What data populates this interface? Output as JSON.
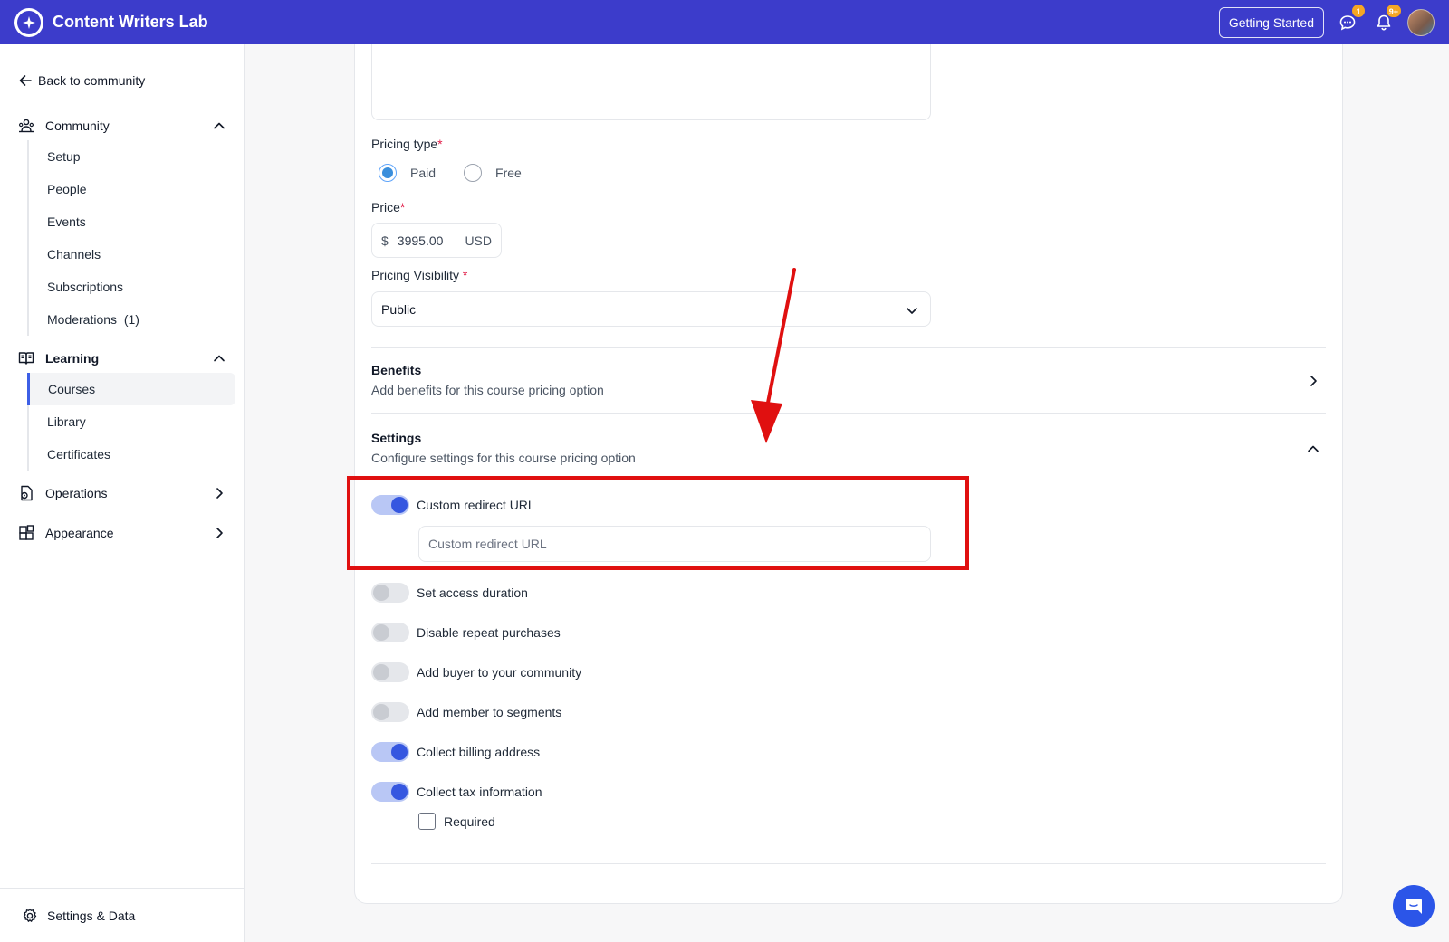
{
  "header": {
    "app_title": "Content Writers Lab",
    "getting_started": "Getting Started",
    "messages_badge": "1",
    "notifications_badge": "9+"
  },
  "sidebar": {
    "back_label": "Back to community",
    "community": {
      "label": "Community",
      "items": [
        "Setup",
        "People",
        "Events",
        "Channels",
        "Subscriptions",
        "Moderations  (1)"
      ]
    },
    "learning": {
      "label": "Learning",
      "items": [
        "Courses",
        "Library",
        "Certificates"
      ],
      "active": "Courses"
    },
    "operations_label": "Operations",
    "appearance_label": "Appearance",
    "footer_label": "Settings & Data"
  },
  "form": {
    "pricing_type_label": "Pricing type",
    "required_mark": "*",
    "pricing_options": [
      {
        "label": "Paid",
        "selected": true
      },
      {
        "label": "Free",
        "selected": false
      }
    ],
    "price_label": "Price",
    "currency_symbol": "$",
    "price_value": "3995.00",
    "currency_code": "USD",
    "visibility_label": "Pricing Visibility",
    "visibility_value": "Public",
    "benefits": {
      "title": "Benefits",
      "description": "Add benefits for this course pricing option"
    },
    "settings": {
      "title": "Settings",
      "description": "Configure settings for this course pricing option"
    },
    "toggles": [
      {
        "label": "Custom redirect URL",
        "on": true
      },
      {
        "label": "Set access duration",
        "on": false
      },
      {
        "label": "Disable repeat purchases",
        "on": false
      },
      {
        "label": "Add buyer to your community",
        "on": false
      },
      {
        "label": "Add member to segments",
        "on": false
      },
      {
        "label": "Collect billing address",
        "on": true
      },
      {
        "label": "Collect tax information",
        "on": true
      }
    ],
    "redirect_url_placeholder": "Custom redirect URL",
    "required_checkbox_label": "Required",
    "required_checked": false
  },
  "colors": {
    "brand": "#3c3ccb",
    "accent": "#3557e0",
    "annotation": "#e01010"
  }
}
